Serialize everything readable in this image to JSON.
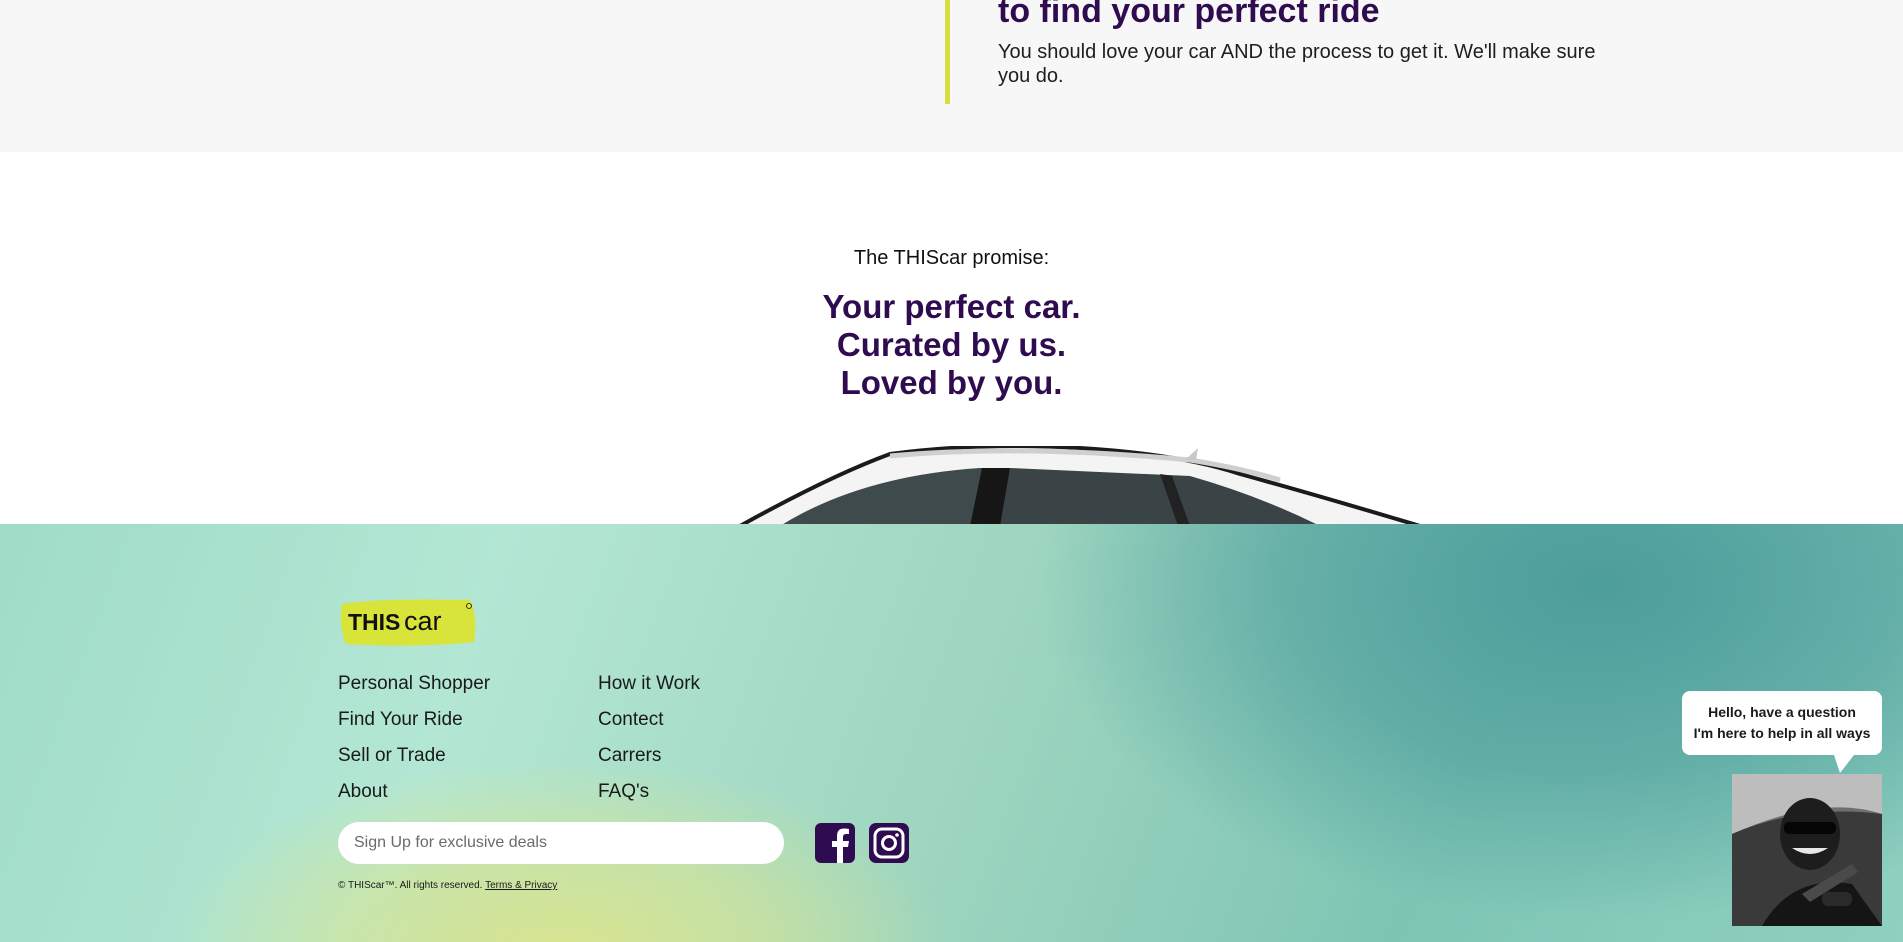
{
  "hero": {
    "heading": "to find your perfect ride",
    "body": "You should love your car AND the process to get it. We'll make sure you do."
  },
  "promise": {
    "label": "The THIScar promise:",
    "lines": [
      "Your perfect car.",
      "Curated by us.",
      "Loved by you."
    ]
  },
  "footer": {
    "logo": {
      "prefix": "THIS",
      "suffix": "car"
    },
    "nav_col1": [
      "Personal Shopper",
      "Find Your Ride",
      "Sell or Trade",
      "About"
    ],
    "nav_col2": [
      "How it Work",
      "Contect",
      "Carrers",
      "FAQ's"
    ],
    "signup_placeholder": "Sign Up for exclusive deals",
    "social": [
      "facebook-icon",
      "instagram-icon"
    ],
    "copyright": "© THIScar™. All rights reserved.",
    "terms_link": "Terms & Privacy"
  },
  "chat": {
    "line1": "Hello, have a question",
    "line2": "I'm here to help in all ways"
  },
  "colors": {
    "brand_purple": "#2e0c4f",
    "accent_yellow": "#d4de3f",
    "footer_teal": "#9fdcc8",
    "footer_teal_dark": "#4d9d9c",
    "footer_lime": "#d9e48f"
  }
}
